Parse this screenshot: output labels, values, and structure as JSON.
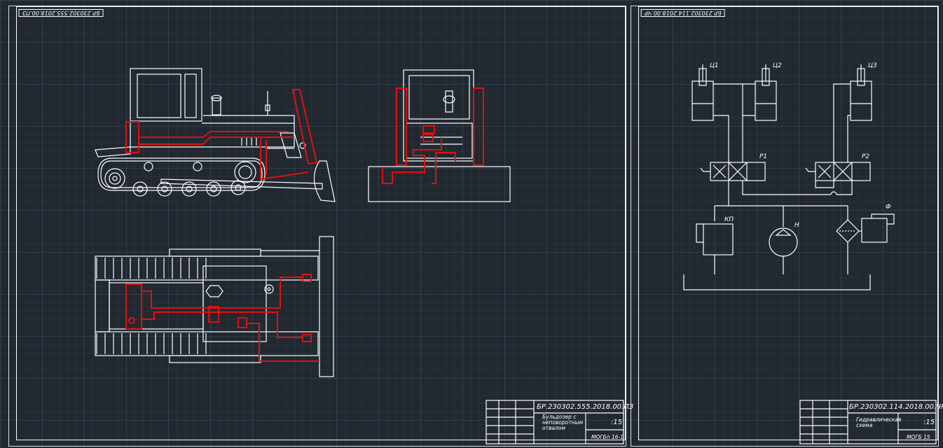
{
  "sheet_left": {
    "stamp": "БР.230302.555.2018.00.ПЗ",
    "title_block": {
      "code": "БР.230302.555.2018.00.ПЗ",
      "name_lines": [
        "Бульдозер с",
        "неповоротным",
        "отвалом"
      ],
      "scale": ":15",
      "org": "МОГБп 16-1"
    }
  },
  "sheet_right": {
    "stamp": "БР.230302.114.2018.00.ЧР",
    "title_block": {
      "code": "БР.230302.114.2018.00.ЧР",
      "name_lines": [
        "Гидравлическая",
        "схема"
      ],
      "scale": ":15",
      "org": "МОГБ 15"
    },
    "labels": {
      "c1": "Ц1",
      "c2": "Ц2",
      "c3": "Ц3",
      "p1": "Р1",
      "p2": "Р2",
      "kp": "КП",
      "n": "Н",
      "f": "Ф"
    }
  },
  "colors": {
    "background": "#212830",
    "line": "#ffffff",
    "hydraulic": "#e01010"
  }
}
